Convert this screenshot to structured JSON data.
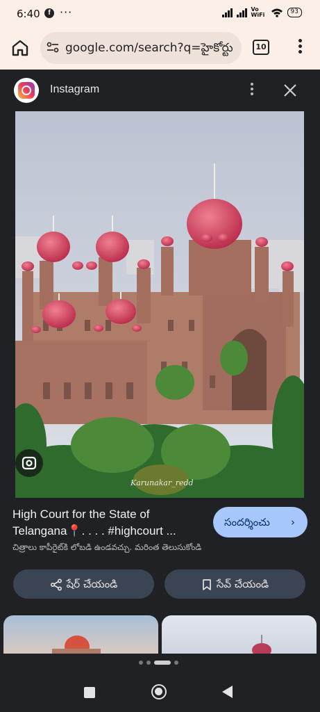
{
  "status_bar": {
    "time": "6:40",
    "notification_icons": [
      "facebook-icon",
      "more-dots-icon"
    ],
    "network_label": "Vo WiFi",
    "battery": "93"
  },
  "browser": {
    "url": "google.com/search?q=హైకోర్టు",
    "tab_count": "10"
  },
  "source": {
    "name": "Instagram",
    "icon": "instagram-icon"
  },
  "image": {
    "watermark": "Karunakar_redd",
    "alt": "High Court building with red domes"
  },
  "result": {
    "caption": "High Court for the State of Telangana📍. . . . #highcourt ...",
    "visit_label": "సందర్శించు",
    "copyright_notice": "చిత్రాలు కాపీరైట్‌కి లోబడి ఉండవచ్చు. మరింత తెలుసుకోండి"
  },
  "actions": {
    "share_label": "షేర్ చేయండి",
    "save_label": "సేవ్ చేయండి"
  },
  "pager": {
    "total": 4,
    "active_index": 2
  },
  "colors": {
    "sheet_bg": "#1f2125",
    "chrome_bg": "#fbefe8",
    "visit_button": "#a8c7fa",
    "action_button": "#3b4452"
  }
}
